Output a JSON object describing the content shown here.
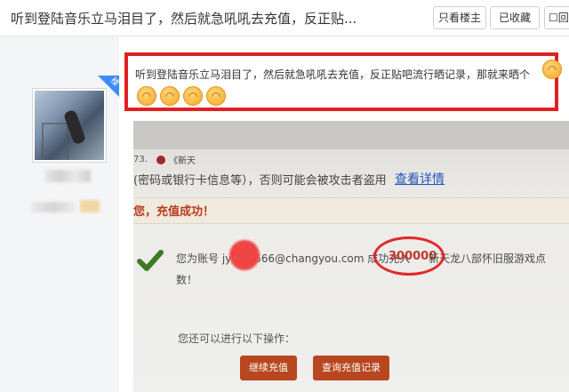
{
  "header": {
    "title": "听到登陆音乐立马泪目了，然后就急吼吼去充值，反正贴...",
    "buttons": {
      "only_op": "只看楼主",
      "favorited": "已收藏",
      "reply": "回"
    }
  },
  "sidebar": {
    "badge": "楼主"
  },
  "post": {
    "text": "听到登陆音乐立马泪目了，然后就急吼吼去充值，反正贴吧流行晒记录，那就来晒个",
    "emoji": [
      "icon",
      "icon",
      "icon",
      "icon",
      "icon"
    ]
  },
  "photo": {
    "tab_number": "73.",
    "tab_name": "《新天",
    "warning": "(密码或银行卡信息等），否则可能会被攻击者盗用",
    "link": "查看详情",
    "success": "您，充值成功！",
    "line1_prefix": "您为账号 jy",
    "line1_mid": "566@changyou.com 成功充入",
    "amount": "300000",
    "game": "新天龙八部怀旧服游戏点",
    "line2": "数！",
    "more_ops": "您还可以进行以下操作：",
    "btn_continue": "继续充值",
    "btn_query": "查询充值记录"
  }
}
